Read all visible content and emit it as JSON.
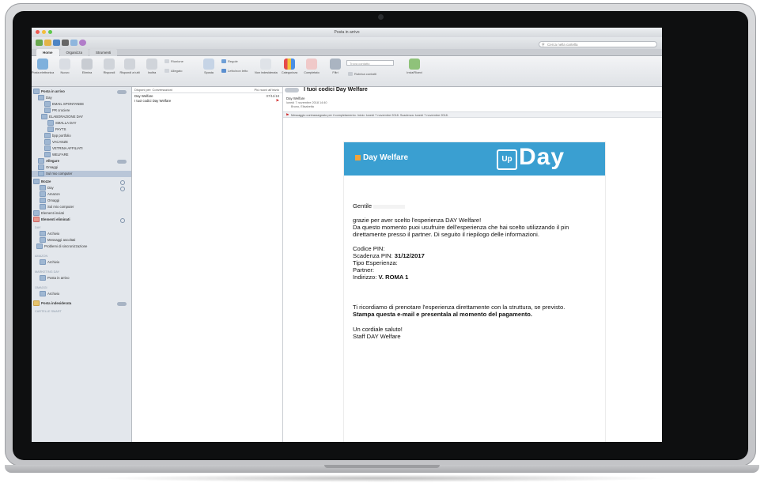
{
  "window": {
    "title": "Posta in arrivo",
    "search_placeholder": "Cerca nella cartella"
  },
  "tabs": [
    {
      "label": "Home"
    },
    {
      "label": "Organizza"
    },
    {
      "label": "Strumenti"
    }
  ],
  "ribbon": {
    "new_email": "Posta elettronica",
    "new_items": "Nuovo",
    "delete": "Elimina",
    "reply": "Rispondi",
    "reply_all": "Rispondi a tutti",
    "forward": "Inoltra",
    "attachment": "Allegato",
    "meeting": "Riunione",
    "move": "Sposta",
    "rules": "Regole",
    "read_unread": "Letto/non letto",
    "categorize": "Categorizza",
    "follow_up": "Completato",
    "filter": "Filtri",
    "find_placeholder": "Trova contatto",
    "address_book": "Rubrica contatti",
    "send_receive": "Invia/Ricevi",
    "non_indesiderata": "Non indesiderata"
  },
  "sidebar": {
    "items": [
      {
        "label": "Posta in arrivo"
      },
      {
        "label": "Day"
      },
      {
        "label": "EMAIL SPONTANEE"
      },
      {
        "label": "PR crociere"
      },
      {
        "label": "ELABORAZIONE DAY"
      },
      {
        "label": "SMALLA DAY"
      },
      {
        "label": "PAYTS"
      },
      {
        "label": "bpp portfolio"
      },
      {
        "label": "VACANZE"
      },
      {
        "label": "VETRINA AFFILIATI"
      },
      {
        "label": "WELFARE"
      },
      {
        "label": "Allegare"
      },
      {
        "label": "Omaggi"
      },
      {
        "label": "Sul mio computer"
      },
      {
        "label": "Bozze"
      },
      {
        "label": "Day"
      },
      {
        "label": "Amazon"
      },
      {
        "label": "Omaggi"
      },
      {
        "label": "Sul mio computer"
      },
      {
        "label": "Elementi inviati"
      },
      {
        "label": "Elementi eliminati"
      },
      {
        "label": "DAY"
      },
      {
        "label": "Archivio"
      },
      {
        "label": "Messaggi ascoltati"
      },
      {
        "label": "Problemi di sincronizzazione"
      },
      {
        "label": "AMAZON"
      },
      {
        "label": "Archivio"
      },
      {
        "label": "MARKETING DAY"
      },
      {
        "label": "Posta in arrivo"
      },
      {
        "label": "OMAGGI"
      },
      {
        "label": "Archivio"
      },
      {
        "label": "Posta indesiderata"
      },
      {
        "label": "CARTELLE SMART"
      }
    ]
  },
  "message_list": {
    "sort_label": "Disponi per: Conversazioni",
    "order_label": "Più nuovi all'inizio",
    "messages": [
      {
        "sender": "Day Welfare",
        "subject": "I tuoi codici Day Welfare",
        "time": "07/11/18"
      }
    ]
  },
  "reading": {
    "subject": "I tuoi codici Day Welfare",
    "from": "Day Welfare",
    "date": "lunedì 7 novembre 2018 14:40",
    "to": "Bruno, Elisabetta",
    "flag_text": "Messaggio contrassegnato per il completamento. Inizio: lunedì 7 novembre 2018. Scadenza: lunedì 7 novembre 2018."
  },
  "email": {
    "brand_left": "Day Welfare",
    "brand_up": "Up",
    "brand_day": "Day",
    "greeting": "Gentile",
    "line1": "grazie per aver scelto l'esperienza DAY Welfare!",
    "line2": "Da questo momento puoi usufruire dell'esperienza che hai scelto utilizzando il pin",
    "line3": "direttamente presso il partner. Di seguito il riepilogo delle informazioni.",
    "pin_label": "Codice PIN:",
    "expiry_label": "Scadenza PIN:",
    "expiry_value": "31/12/2017",
    "type_label": "Tipo Esperienza:",
    "partner_label": "Partner:",
    "address_label": "Indirizzo:",
    "address_value": "V. ROMA 1",
    "reminder": "Ti ricordiamo di prenotare l'esperienza direttamente con la struttura, se previsto.",
    "print_note": "Stampa questa e-mail e presentala al momento del pagamento.",
    "closing": "Un cordiale saluto!",
    "signature": "Staff DAY Welfare"
  },
  "colors": {
    "banner_blue": "#3a9fd1",
    "banner_orange": "#f2a43a",
    "sidebar_bg": "#e3e7ec",
    "flag_red": "#d02b2b"
  }
}
